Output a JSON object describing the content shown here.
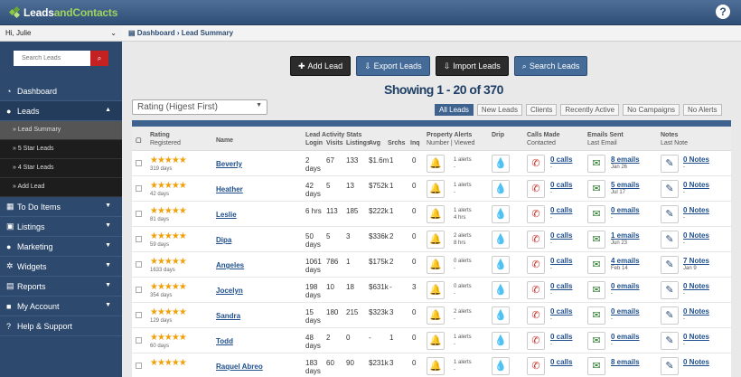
{
  "brand": {
    "logo_part1": "Leads",
    "logo_part2": "and",
    "logo_part3": "Contacts"
  },
  "user": {
    "greeting": "Hi, Julie"
  },
  "sidebar": {
    "search_placeholder": "Search Leads",
    "items": [
      {
        "label": "Dashboard",
        "icon": "dashboard-icon"
      },
      {
        "label": "Leads",
        "icon": "user-icon"
      },
      {
        "label": "To Do Items",
        "icon": "calendar-icon"
      },
      {
        "label": "Listings",
        "icon": "car-icon"
      },
      {
        "label": "Marketing",
        "icon": "droplet-icon"
      },
      {
        "label": "Widgets",
        "icon": "cogs-icon"
      },
      {
        "label": "Reports",
        "icon": "report-icon"
      },
      {
        "label": "My Account",
        "icon": "account-icon"
      },
      {
        "label": "Help & Support",
        "icon": "question-icon"
      }
    ],
    "subitems": [
      "Lead Summary",
      "5 Star Leads",
      "4 Star Leads",
      "Add Lead"
    ]
  },
  "breadcrumb": {
    "root": "Dashboard",
    "current": "Lead Summary"
  },
  "actions": [
    "Add Lead",
    "Export Leads",
    "Import Leads",
    "Search Leads"
  ],
  "showing": "Showing 1 - 20 of 370",
  "sort": {
    "selected": "Rating (Higest First)"
  },
  "filters": [
    "All Leads",
    "New Leads",
    "Clients",
    "Recently Active",
    "No Campaigns",
    "No Alerts"
  ],
  "headers": {
    "rating": "Rating",
    "registered": "Registered",
    "name": "Name",
    "lead_activity": "Lead Activity Stats",
    "login": "Login",
    "visits": "Visits",
    "listings": "Listings",
    "avg": "Avg",
    "srchs": "Srchs",
    "inq": "Inq",
    "property_alerts": "Property Alerts",
    "number_viewed": "Number | Viewed",
    "drip": "Drip",
    "calls_made": "Calls Made",
    "contacted": "Contacted",
    "emails_sent": "Emails Sent",
    "last_email": "Last Email",
    "notes": "Notes",
    "last_note": "Last Note"
  },
  "rows": [
    {
      "registered": "319 days",
      "name": "Beverly",
      "login1": "2",
      "login2": "days",
      "visits": "67",
      "listings": "133",
      "avg": "$1.6m",
      "srchs": "1",
      "inq": "0",
      "alert1": "1 alerts",
      "alert2": "-",
      "drip": "red",
      "calls": "0 calls",
      "call_last": "-",
      "emails": "8 emails",
      "email_last": "Jan 26",
      "notes": "0 Notes",
      "note_last": "-"
    },
    {
      "registered": "42 days",
      "name": "Heather",
      "login1": "42",
      "login2": "days",
      "visits": "5",
      "listings": "13",
      "avg": "$752k",
      "srchs": "1",
      "inq": "0",
      "alert1": "1 alerts",
      "alert2": "-",
      "drip": "green",
      "calls": "0 calls",
      "call_last": "-",
      "emails": "5 emails",
      "email_last": "Jul 17",
      "notes": "0 Notes",
      "note_last": "-"
    },
    {
      "registered": "81 days",
      "name": "Leslie",
      "login1": "6 hrs",
      "login2": "",
      "visits": "113",
      "listings": "185",
      "avg": "$222k",
      "srchs": "1",
      "inq": "0",
      "alert1": "1 alerts",
      "alert2": "4 hrs",
      "drip": "red",
      "calls": "0 calls",
      "call_last": "-",
      "emails": "0 emails",
      "email_last": "-",
      "notes": "0 Notes",
      "note_last": "-"
    },
    {
      "registered": "59 days",
      "name": "Dipa",
      "login1": "50",
      "login2": "days",
      "visits": "5",
      "listings": "3",
      "avg": "$336k",
      "srchs": "2",
      "inq": "0",
      "alert1": "2 alerts",
      "alert2": "8 hrs",
      "drip": "red",
      "calls": "0 calls",
      "call_last": "-",
      "emails": "1 emails",
      "email_last": "Jun 23",
      "notes": "0 Notes",
      "note_last": "-"
    },
    {
      "registered": "1633 days",
      "name": "Angeles",
      "login1": "1061",
      "login2": "days",
      "visits": "786",
      "listings": "1",
      "avg": "$175k",
      "srchs": "2",
      "inq": "0",
      "alert1": "0 alerts",
      "alert2": "-",
      "drip": "red",
      "calls": "0 calls",
      "call_last": "-",
      "emails": "4 emails",
      "email_last": "Feb 14",
      "notes": "7 Notes",
      "note_last": "Jan 9"
    },
    {
      "registered": "354 days",
      "name": "Jocelyn",
      "login1": "198",
      "login2": "days",
      "visits": "10",
      "listings": "18",
      "avg": "$631k",
      "srchs": "-",
      "inq": "3",
      "alert1": "0 alerts",
      "alert2": "-",
      "drip": "red",
      "calls": "0 calls",
      "call_last": "-",
      "emails": "0 emails",
      "email_last": "-",
      "notes": "0 Notes",
      "note_last": "-"
    },
    {
      "registered": "129 days",
      "name": "Sandra",
      "login1": "15",
      "login2": "days",
      "visits": "180",
      "listings": "215",
      "avg": "$323k",
      "srchs": "3",
      "inq": "0",
      "alert1": "2 alerts",
      "alert2": "-",
      "drip": "red",
      "calls": "0 calls",
      "call_last": "-",
      "emails": "0 emails",
      "email_last": "-",
      "notes": "0 Notes",
      "note_last": "-"
    },
    {
      "registered": "60 days",
      "name": "Todd",
      "login1": "48",
      "login2": "days",
      "visits": "2",
      "listings": "0",
      "avg": "-",
      "srchs": "1",
      "inq": "0",
      "alert1": "1 alerts",
      "alert2": "-",
      "drip": "red",
      "calls": "0 calls",
      "call_last": "-",
      "emails": "0 emails",
      "email_last": "-",
      "notes": "0 Notes",
      "note_last": "-"
    },
    {
      "registered": "",
      "name": "Raquel Abreo",
      "login1": "183",
      "login2": "days",
      "visits": "60",
      "listings": "90",
      "avg": "$231k",
      "srchs": "3",
      "inq": "0",
      "alert1": "1 alerts",
      "alert2": "-",
      "drip": "red",
      "calls": "0 calls",
      "call_last": "",
      "emails": "8 emails",
      "email_last": "",
      "notes": "0 Notes",
      "note_last": ""
    }
  ]
}
